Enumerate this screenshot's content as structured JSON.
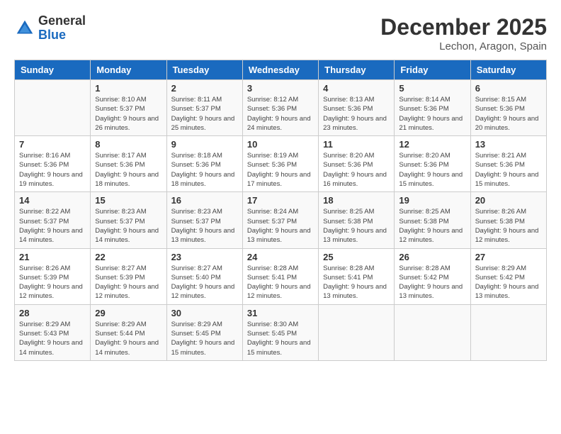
{
  "header": {
    "logo_general": "General",
    "logo_blue": "Blue",
    "month": "December 2025",
    "location": "Lechon, Aragon, Spain"
  },
  "weekdays": [
    "Sunday",
    "Monday",
    "Tuesday",
    "Wednesday",
    "Thursday",
    "Friday",
    "Saturday"
  ],
  "weeks": [
    [
      {
        "day": "",
        "sunrise": "",
        "sunset": "",
        "daylight": ""
      },
      {
        "day": "1",
        "sunrise": "Sunrise: 8:10 AM",
        "sunset": "Sunset: 5:37 PM",
        "daylight": "Daylight: 9 hours and 26 minutes."
      },
      {
        "day": "2",
        "sunrise": "Sunrise: 8:11 AM",
        "sunset": "Sunset: 5:37 PM",
        "daylight": "Daylight: 9 hours and 25 minutes."
      },
      {
        "day": "3",
        "sunrise": "Sunrise: 8:12 AM",
        "sunset": "Sunset: 5:36 PM",
        "daylight": "Daylight: 9 hours and 24 minutes."
      },
      {
        "day": "4",
        "sunrise": "Sunrise: 8:13 AM",
        "sunset": "Sunset: 5:36 PM",
        "daylight": "Daylight: 9 hours and 23 minutes."
      },
      {
        "day": "5",
        "sunrise": "Sunrise: 8:14 AM",
        "sunset": "Sunset: 5:36 PM",
        "daylight": "Daylight: 9 hours and 21 minutes."
      },
      {
        "day": "6",
        "sunrise": "Sunrise: 8:15 AM",
        "sunset": "Sunset: 5:36 PM",
        "daylight": "Daylight: 9 hours and 20 minutes."
      }
    ],
    [
      {
        "day": "7",
        "sunrise": "Sunrise: 8:16 AM",
        "sunset": "Sunset: 5:36 PM",
        "daylight": "Daylight: 9 hours and 19 minutes."
      },
      {
        "day": "8",
        "sunrise": "Sunrise: 8:17 AM",
        "sunset": "Sunset: 5:36 PM",
        "daylight": "Daylight: 9 hours and 18 minutes."
      },
      {
        "day": "9",
        "sunrise": "Sunrise: 8:18 AM",
        "sunset": "Sunset: 5:36 PM",
        "daylight": "Daylight: 9 hours and 18 minutes."
      },
      {
        "day": "10",
        "sunrise": "Sunrise: 8:19 AM",
        "sunset": "Sunset: 5:36 PM",
        "daylight": "Daylight: 9 hours and 17 minutes."
      },
      {
        "day": "11",
        "sunrise": "Sunrise: 8:20 AM",
        "sunset": "Sunset: 5:36 PM",
        "daylight": "Daylight: 9 hours and 16 minutes."
      },
      {
        "day": "12",
        "sunrise": "Sunrise: 8:20 AM",
        "sunset": "Sunset: 5:36 PM",
        "daylight": "Daylight: 9 hours and 15 minutes."
      },
      {
        "day": "13",
        "sunrise": "Sunrise: 8:21 AM",
        "sunset": "Sunset: 5:36 PM",
        "daylight": "Daylight: 9 hours and 15 minutes."
      }
    ],
    [
      {
        "day": "14",
        "sunrise": "Sunrise: 8:22 AM",
        "sunset": "Sunset: 5:37 PM",
        "daylight": "Daylight: 9 hours and 14 minutes."
      },
      {
        "day": "15",
        "sunrise": "Sunrise: 8:23 AM",
        "sunset": "Sunset: 5:37 PM",
        "daylight": "Daylight: 9 hours and 14 minutes."
      },
      {
        "day": "16",
        "sunrise": "Sunrise: 8:23 AM",
        "sunset": "Sunset: 5:37 PM",
        "daylight": "Daylight: 9 hours and 13 minutes."
      },
      {
        "day": "17",
        "sunrise": "Sunrise: 8:24 AM",
        "sunset": "Sunset: 5:37 PM",
        "daylight": "Daylight: 9 hours and 13 minutes."
      },
      {
        "day": "18",
        "sunrise": "Sunrise: 8:25 AM",
        "sunset": "Sunset: 5:38 PM",
        "daylight": "Daylight: 9 hours and 13 minutes."
      },
      {
        "day": "19",
        "sunrise": "Sunrise: 8:25 AM",
        "sunset": "Sunset: 5:38 PM",
        "daylight": "Daylight: 9 hours and 12 minutes."
      },
      {
        "day": "20",
        "sunrise": "Sunrise: 8:26 AM",
        "sunset": "Sunset: 5:38 PM",
        "daylight": "Daylight: 9 hours and 12 minutes."
      }
    ],
    [
      {
        "day": "21",
        "sunrise": "Sunrise: 8:26 AM",
        "sunset": "Sunset: 5:39 PM",
        "daylight": "Daylight: 9 hours and 12 minutes."
      },
      {
        "day": "22",
        "sunrise": "Sunrise: 8:27 AM",
        "sunset": "Sunset: 5:39 PM",
        "daylight": "Daylight: 9 hours and 12 minutes."
      },
      {
        "day": "23",
        "sunrise": "Sunrise: 8:27 AM",
        "sunset": "Sunset: 5:40 PM",
        "daylight": "Daylight: 9 hours and 12 minutes."
      },
      {
        "day": "24",
        "sunrise": "Sunrise: 8:28 AM",
        "sunset": "Sunset: 5:41 PM",
        "daylight": "Daylight: 9 hours and 12 minutes."
      },
      {
        "day": "25",
        "sunrise": "Sunrise: 8:28 AM",
        "sunset": "Sunset: 5:41 PM",
        "daylight": "Daylight: 9 hours and 13 minutes."
      },
      {
        "day": "26",
        "sunrise": "Sunrise: 8:28 AM",
        "sunset": "Sunset: 5:42 PM",
        "daylight": "Daylight: 9 hours and 13 minutes."
      },
      {
        "day": "27",
        "sunrise": "Sunrise: 8:29 AM",
        "sunset": "Sunset: 5:42 PM",
        "daylight": "Daylight: 9 hours and 13 minutes."
      }
    ],
    [
      {
        "day": "28",
        "sunrise": "Sunrise: 8:29 AM",
        "sunset": "Sunset: 5:43 PM",
        "daylight": "Daylight: 9 hours and 14 minutes."
      },
      {
        "day": "29",
        "sunrise": "Sunrise: 8:29 AM",
        "sunset": "Sunset: 5:44 PM",
        "daylight": "Daylight: 9 hours and 14 minutes."
      },
      {
        "day": "30",
        "sunrise": "Sunrise: 8:29 AM",
        "sunset": "Sunset: 5:45 PM",
        "daylight": "Daylight: 9 hours and 15 minutes."
      },
      {
        "day": "31",
        "sunrise": "Sunrise: 8:30 AM",
        "sunset": "Sunset: 5:45 PM",
        "daylight": "Daylight: 9 hours and 15 minutes."
      },
      {
        "day": "",
        "sunrise": "",
        "sunset": "",
        "daylight": ""
      },
      {
        "day": "",
        "sunrise": "",
        "sunset": "",
        "daylight": ""
      },
      {
        "day": "",
        "sunrise": "",
        "sunset": "",
        "daylight": ""
      }
    ]
  ]
}
